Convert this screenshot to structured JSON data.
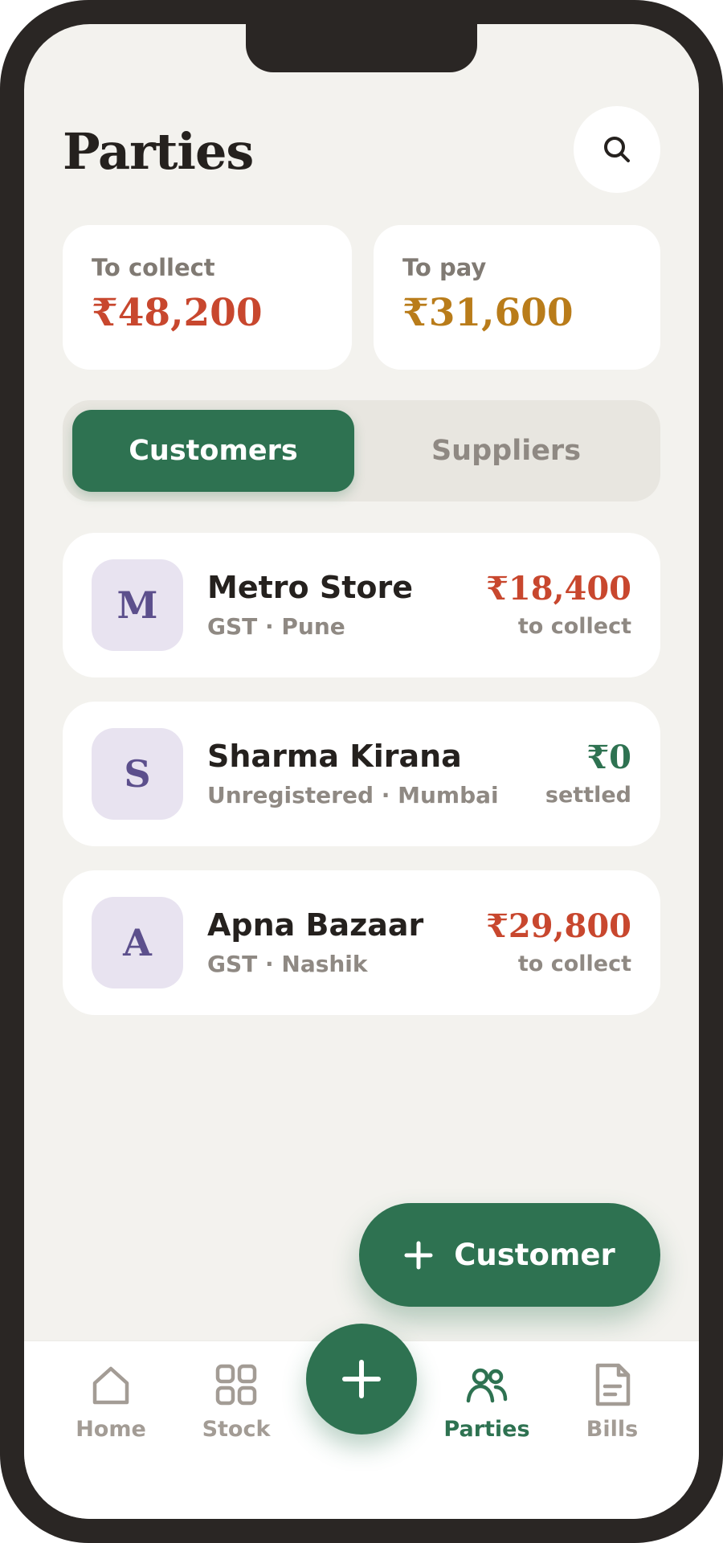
{
  "header": {
    "title": "Parties",
    "search_icon": "search-icon"
  },
  "summary": {
    "collect": {
      "label": "To collect",
      "value": "₹48,200",
      "color": "#c8472e"
    },
    "pay": {
      "label": "To pay",
      "value": "₹31,600",
      "color": "#b97c1a"
    }
  },
  "segments": {
    "selected": "Customers",
    "items": [
      "Customers",
      "Suppliers"
    ]
  },
  "parties": [
    {
      "initial": "M",
      "name": "Metro Store",
      "sub": "GST · Pune",
      "amount": "₹18,400",
      "status": "to collect",
      "amount_color": "#c8472e"
    },
    {
      "initial": "S",
      "name": "Sharma Kirana",
      "sub": "Unregistered · Mumbai",
      "amount": "₹0",
      "status": "settled",
      "amount_color": "#2e7251"
    },
    {
      "initial": "A",
      "name": "Apna Bazaar",
      "sub": "GST · Nashik",
      "amount": "₹29,800",
      "status": "to collect",
      "amount_color": "#c8472e"
    }
  ],
  "fab": {
    "label": "Customer",
    "icon": "plus-icon"
  },
  "tabbar": {
    "items": [
      {
        "label": "Home",
        "icon": "home-icon",
        "active": false
      },
      {
        "label": "Stock",
        "icon": "grid-icon",
        "active": false
      },
      {
        "label": "Parties",
        "icon": "users-icon",
        "active": true
      },
      {
        "label": "Bills",
        "icon": "document-icon",
        "active": false
      }
    ],
    "center_action_icon": "plus-icon"
  },
  "colors": {
    "accent": "#2e7251",
    "background": "#f3f2ee",
    "collect": "#c8472e",
    "pay": "#b97c1a",
    "muted": "#8f8983"
  }
}
